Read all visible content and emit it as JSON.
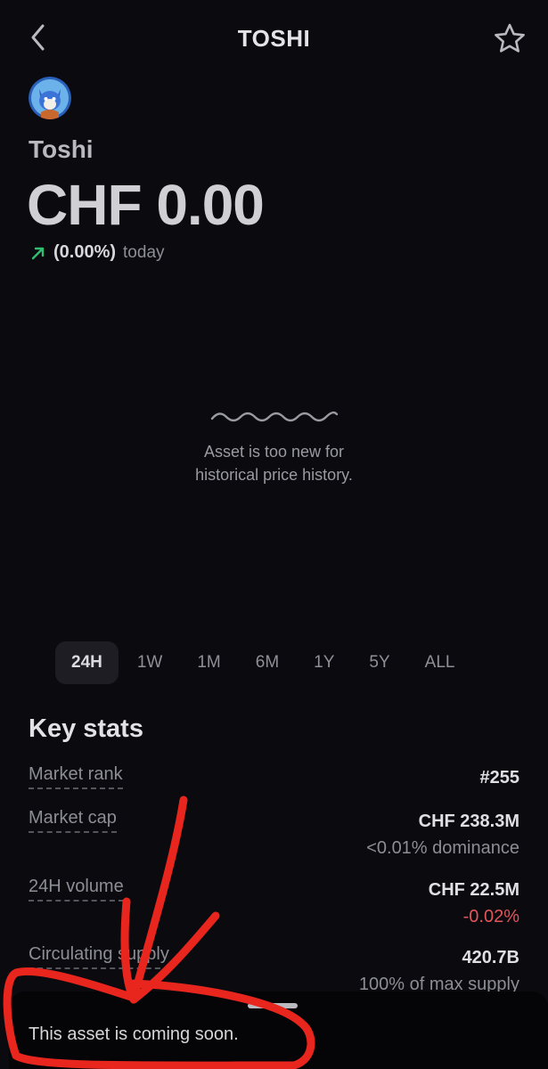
{
  "header": {
    "title": "TOSHI",
    "back_icon": "chevron-left-icon",
    "favorite_icon": "star-icon"
  },
  "asset": {
    "name": "Toshi",
    "price": "CHF 0.00",
    "change_pct": "(0.00%)",
    "change_period": "today",
    "change_direction": "up",
    "up_color": "#2fbf71"
  },
  "chart": {
    "empty_message_line1": "Asset is too new for",
    "empty_message_line2": "historical price history."
  },
  "ranges": [
    {
      "label": "24H",
      "active": true
    },
    {
      "label": "1W",
      "active": false
    },
    {
      "label": "1M",
      "active": false
    },
    {
      "label": "6M",
      "active": false
    },
    {
      "label": "1Y",
      "active": false
    },
    {
      "label": "5Y",
      "active": false
    },
    {
      "label": "ALL",
      "active": false
    }
  ],
  "key_stats": {
    "title": "Key stats",
    "market_rank": {
      "label": "Market rank",
      "value": "#255"
    },
    "market_cap": {
      "label": "Market cap",
      "value": "CHF 238.3M",
      "sub": "<0.01% dominance"
    },
    "volume_24h": {
      "label": "24H volume",
      "value": "CHF 22.5M",
      "sub": "-0.02%"
    },
    "circulating_supply": {
      "label": "Circulating supply",
      "value": "420.7B",
      "sub": "100% of max supply"
    }
  },
  "sheet": {
    "message": "This asset is coming soon."
  },
  "annotation": {
    "color": "#e8261e"
  }
}
